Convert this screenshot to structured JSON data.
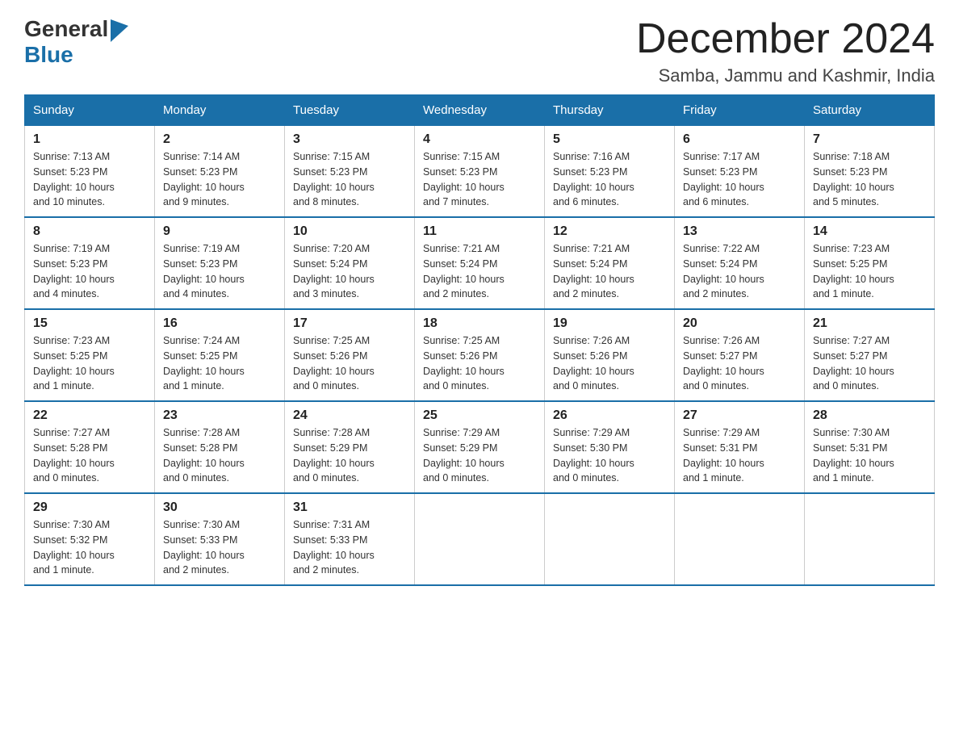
{
  "logo": {
    "general": "General",
    "blue": "Blue"
  },
  "header": {
    "month": "December 2024",
    "location": "Samba, Jammu and Kashmir, India"
  },
  "weekdays": [
    "Sunday",
    "Monday",
    "Tuesday",
    "Wednesday",
    "Thursday",
    "Friday",
    "Saturday"
  ],
  "weeks": [
    [
      {
        "day": "1",
        "sunrise": "7:13 AM",
        "sunset": "5:23 PM",
        "daylight": "10 hours and 10 minutes."
      },
      {
        "day": "2",
        "sunrise": "7:14 AM",
        "sunset": "5:23 PM",
        "daylight": "10 hours and 9 minutes."
      },
      {
        "day": "3",
        "sunrise": "7:15 AM",
        "sunset": "5:23 PM",
        "daylight": "10 hours and 8 minutes."
      },
      {
        "day": "4",
        "sunrise": "7:15 AM",
        "sunset": "5:23 PM",
        "daylight": "10 hours and 7 minutes."
      },
      {
        "day": "5",
        "sunrise": "7:16 AM",
        "sunset": "5:23 PM",
        "daylight": "10 hours and 6 minutes."
      },
      {
        "day": "6",
        "sunrise": "7:17 AM",
        "sunset": "5:23 PM",
        "daylight": "10 hours and 6 minutes."
      },
      {
        "day": "7",
        "sunrise": "7:18 AM",
        "sunset": "5:23 PM",
        "daylight": "10 hours and 5 minutes."
      }
    ],
    [
      {
        "day": "8",
        "sunrise": "7:19 AM",
        "sunset": "5:23 PM",
        "daylight": "10 hours and 4 minutes."
      },
      {
        "day": "9",
        "sunrise": "7:19 AM",
        "sunset": "5:23 PM",
        "daylight": "10 hours and 4 minutes."
      },
      {
        "day": "10",
        "sunrise": "7:20 AM",
        "sunset": "5:24 PM",
        "daylight": "10 hours and 3 minutes."
      },
      {
        "day": "11",
        "sunrise": "7:21 AM",
        "sunset": "5:24 PM",
        "daylight": "10 hours and 2 minutes."
      },
      {
        "day": "12",
        "sunrise": "7:21 AM",
        "sunset": "5:24 PM",
        "daylight": "10 hours and 2 minutes."
      },
      {
        "day": "13",
        "sunrise": "7:22 AM",
        "sunset": "5:24 PM",
        "daylight": "10 hours and 2 minutes."
      },
      {
        "day": "14",
        "sunrise": "7:23 AM",
        "sunset": "5:25 PM",
        "daylight": "10 hours and 1 minute."
      }
    ],
    [
      {
        "day": "15",
        "sunrise": "7:23 AM",
        "sunset": "5:25 PM",
        "daylight": "10 hours and 1 minute."
      },
      {
        "day": "16",
        "sunrise": "7:24 AM",
        "sunset": "5:25 PM",
        "daylight": "10 hours and 1 minute."
      },
      {
        "day": "17",
        "sunrise": "7:25 AM",
        "sunset": "5:26 PM",
        "daylight": "10 hours and 0 minutes."
      },
      {
        "day": "18",
        "sunrise": "7:25 AM",
        "sunset": "5:26 PM",
        "daylight": "10 hours and 0 minutes."
      },
      {
        "day": "19",
        "sunrise": "7:26 AM",
        "sunset": "5:26 PM",
        "daylight": "10 hours and 0 minutes."
      },
      {
        "day": "20",
        "sunrise": "7:26 AM",
        "sunset": "5:27 PM",
        "daylight": "10 hours and 0 minutes."
      },
      {
        "day": "21",
        "sunrise": "7:27 AM",
        "sunset": "5:27 PM",
        "daylight": "10 hours and 0 minutes."
      }
    ],
    [
      {
        "day": "22",
        "sunrise": "7:27 AM",
        "sunset": "5:28 PM",
        "daylight": "10 hours and 0 minutes."
      },
      {
        "day": "23",
        "sunrise": "7:28 AM",
        "sunset": "5:28 PM",
        "daylight": "10 hours and 0 minutes."
      },
      {
        "day": "24",
        "sunrise": "7:28 AM",
        "sunset": "5:29 PM",
        "daylight": "10 hours and 0 minutes."
      },
      {
        "day": "25",
        "sunrise": "7:29 AM",
        "sunset": "5:29 PM",
        "daylight": "10 hours and 0 minutes."
      },
      {
        "day": "26",
        "sunrise": "7:29 AM",
        "sunset": "5:30 PM",
        "daylight": "10 hours and 0 minutes."
      },
      {
        "day": "27",
        "sunrise": "7:29 AM",
        "sunset": "5:31 PM",
        "daylight": "10 hours and 1 minute."
      },
      {
        "day": "28",
        "sunrise": "7:30 AM",
        "sunset": "5:31 PM",
        "daylight": "10 hours and 1 minute."
      }
    ],
    [
      {
        "day": "29",
        "sunrise": "7:30 AM",
        "sunset": "5:32 PM",
        "daylight": "10 hours and 1 minute."
      },
      {
        "day": "30",
        "sunrise": "7:30 AM",
        "sunset": "5:33 PM",
        "daylight": "10 hours and 2 minutes."
      },
      {
        "day": "31",
        "sunrise": "7:31 AM",
        "sunset": "5:33 PM",
        "daylight": "10 hours and 2 minutes."
      },
      null,
      null,
      null,
      null
    ]
  ],
  "labels": {
    "sunrise": "Sunrise:",
    "sunset": "Sunset:",
    "daylight": "Daylight:"
  }
}
